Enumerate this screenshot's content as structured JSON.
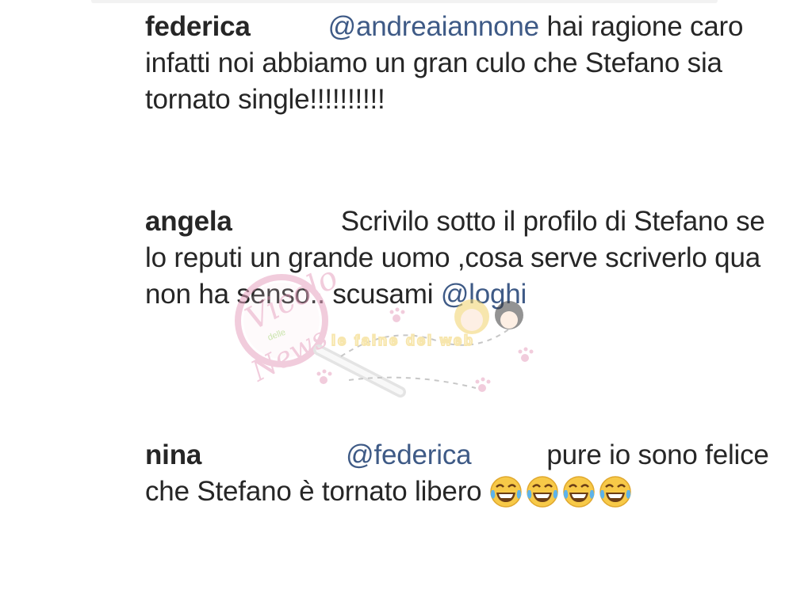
{
  "comments": [
    {
      "username": "federica",
      "mention": "@andreaiannone",
      "text": "hai ragione caro infatti noi abbiamo un gran culo che Stefano sia tornato single!!!!!!!!!!"
    },
    {
      "username": "angela",
      "text": "Scrivilo sotto il profilo di Stefano se lo reputi un grande uomo ,cosa serve scriverlo qua non ha senso.. scusami",
      "mention": "@loghi"
    },
    {
      "username": "nina",
      "mention": "@federica",
      "text": "pure io sono felice che Stefano è tornato libero",
      "emojis": [
        "face-with-tears-of-joy",
        "face-with-tears-of-joy",
        "face-with-tears-of-joy",
        "face-with-tears-of-joy"
      ]
    }
  ],
  "watermark": {
    "brand": "Vicolo delle News",
    "tagline": "le faine del web"
  },
  "colors": {
    "text": "#262626",
    "mention": "#3e5a86",
    "watermark_pink": "#e7a3c0",
    "watermark_yellow": "#f2d36b"
  }
}
